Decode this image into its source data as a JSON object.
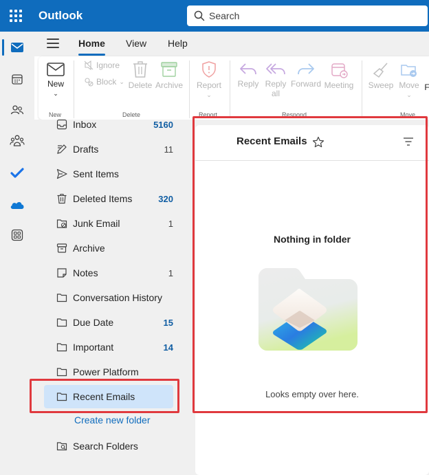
{
  "app": {
    "title": "Outlook"
  },
  "search": {
    "placeholder": "Search"
  },
  "tabs": [
    {
      "label": "Home",
      "active": true
    },
    {
      "label": "View",
      "active": false
    },
    {
      "label": "Help",
      "active": false
    }
  ],
  "ribbon": {
    "new": {
      "label": "New",
      "group": "New"
    },
    "delete_group": {
      "ignore": "Ignore",
      "block": "Block",
      "delete": "Delete",
      "archive": "Archive",
      "group": "Delete"
    },
    "report": {
      "label": "Report",
      "group": "Report"
    },
    "respond": {
      "reply": "Reply",
      "reply_all_line1": "Reply",
      "reply_all_line2": "all",
      "forward": "Forward",
      "meeting": "Meeting",
      "group": "Respond"
    },
    "sweep": "Sweep",
    "move": {
      "label": "Move",
      "group": "Move"
    },
    "truncated": "F"
  },
  "folders": [
    {
      "label": "Inbox",
      "count": "5160",
      "bold_count": true,
      "icon": "inbox-icon"
    },
    {
      "label": "Drafts",
      "count": "11",
      "bold_count": false,
      "icon": "drafts-icon"
    },
    {
      "label": "Sent Items",
      "count": "",
      "bold_count": false,
      "icon": "sent-icon"
    },
    {
      "label": "Deleted Items",
      "count": "320",
      "bold_count": true,
      "icon": "trash-icon"
    },
    {
      "label": "Junk Email",
      "count": "1",
      "bold_count": false,
      "icon": "junk-icon"
    },
    {
      "label": "Archive",
      "count": "",
      "bold_count": false,
      "icon": "archive-icon"
    },
    {
      "label": "Notes",
      "count": "1",
      "bold_count": false,
      "icon": "notes-icon"
    },
    {
      "label": "Conversation History",
      "count": "",
      "bold_count": false,
      "icon": "folder-icon"
    },
    {
      "label": "Due Date",
      "count": "15",
      "bold_count": true,
      "icon": "folder-icon"
    },
    {
      "label": "Important",
      "count": "14",
      "bold_count": true,
      "icon": "folder-icon"
    },
    {
      "label": "Power Platform",
      "count": "",
      "bold_count": false,
      "icon": "folder-icon"
    },
    {
      "label": "Recent Emails",
      "count": "",
      "bold_count": false,
      "icon": "folder-icon",
      "selected": true
    }
  ],
  "create_folder": "Create new folder",
  "search_folders": "Search Folders",
  "message_list": {
    "title": "Recent Emails",
    "empty_title": "Nothing in folder",
    "empty_subtitle": "Looks empty over here."
  },
  "colors": {
    "brand": "#0f6cbd",
    "highlight": "#e0393e",
    "selected": "#cfe4fa"
  }
}
